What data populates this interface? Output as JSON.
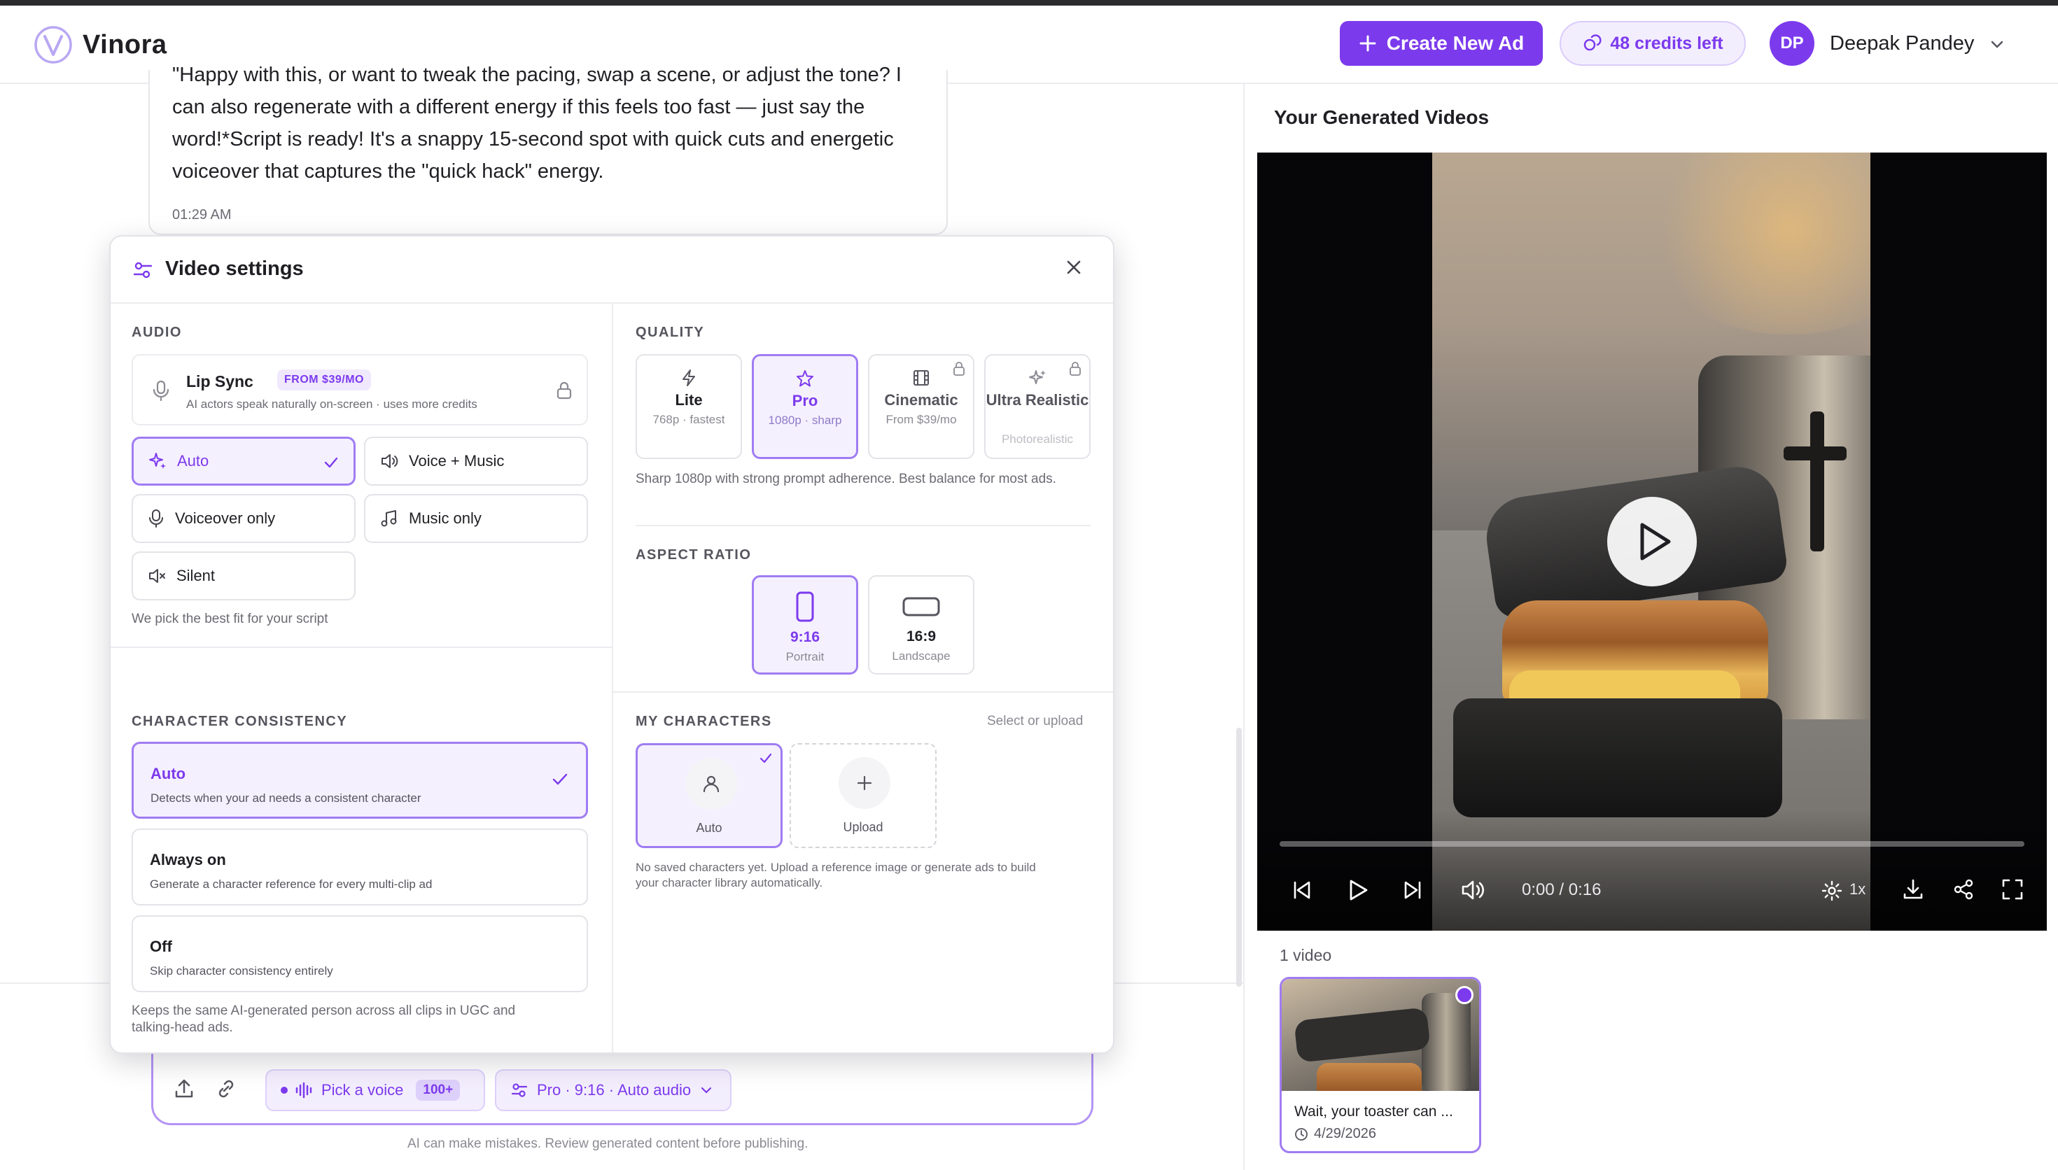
{
  "app": {
    "name": "Vinora"
  },
  "header": {
    "create_label": "Create New Ad",
    "credits_label": "48 credits left",
    "user_initials": "DP",
    "user_name": "Deepak Pandey"
  },
  "chat": {
    "message_lines": [
      "\"Happy with this, or want to tweak the pacing, swap a scene, or adjust the tone? I",
      "can also regenerate with a different energy if this feels too fast — just say the",
      "word!*Script is ready! It's a snappy 15-second spot with quick cuts and energetic",
      "voiceover that captures the \"quick hack\" energy."
    ],
    "time": "01:29 AM"
  },
  "composer": {
    "voice_label": "Pick a voice",
    "voice_count": "100+",
    "settings_summary": "Pro · 9:16 · Auto audio",
    "disclaimer": "AI can make mistakes. Review generated content before publishing."
  },
  "modal": {
    "title": "Video settings",
    "audio": {
      "section_label": "AUDIO",
      "lipsync_title": "Lip Sync",
      "lipsync_badge": "FROM $39/MO",
      "lipsync_desc": "AI actors speak naturally on-screen · uses more credits",
      "options": [
        {
          "label": "Auto",
          "selected": true
        },
        {
          "label": "Voice + Music",
          "selected": false
        },
        {
          "label": "Voiceover only",
          "selected": false
        },
        {
          "label": "Music only",
          "selected": false
        },
        {
          "label": "Silent",
          "selected": false
        }
      ],
      "hint": "We pick the best fit for your script"
    },
    "quality": {
      "section_label": "QUALITY",
      "cards": [
        {
          "title": "Lite",
          "sub": "768p · fastest",
          "selected": false,
          "locked": false
        },
        {
          "title": "Pro",
          "sub": "1080p · sharp",
          "selected": true,
          "locked": false
        },
        {
          "title": "Cinematic",
          "sub": "From $39/mo",
          "selected": false,
          "locked": true
        },
        {
          "title": "Ultra Realistic",
          "sub": "Photorealistic",
          "selected": false,
          "locked": true
        }
      ],
      "hint": "Sharp 1080p with strong prompt adherence. Best balance for most ads."
    },
    "aspect": {
      "section_label": "ASPECT RATIO",
      "cards": [
        {
          "title": "9:16",
          "sub": "Portrait",
          "selected": true
        },
        {
          "title": "16:9",
          "sub": "Landscape",
          "selected": false
        }
      ]
    },
    "consistency": {
      "section_label": "CHARACTER CONSISTENCY",
      "options": [
        {
          "title": "Auto",
          "desc": "Detects when your ad needs a consistent character",
          "selected": true
        },
        {
          "title": "Always on",
          "desc": "Generate a character reference for every multi-clip ad",
          "selected": false
        },
        {
          "title": "Off",
          "desc": "Skip character consistency entirely",
          "selected": false
        }
      ],
      "hint_line1": "Keeps the same AI-generated person across all clips in UGC and",
      "hint_line2": "talking-head ads."
    },
    "characters": {
      "section_label": "MY CHARACTERS",
      "side_hint": "Select or upload",
      "auto_label": "Auto",
      "upload_label": "Upload",
      "hint_line1": "No saved characters yet. Upload a reference image or generate ads to build",
      "hint_line2": "your character library automatically."
    }
  },
  "videos": {
    "panel_title": "Your Generated Videos",
    "time_display": "0:00 / 0:16",
    "speed": "1x",
    "progress": 0,
    "count_label": "1 video",
    "items": [
      {
        "title": "Wait, your toaster can ...",
        "date": "4/29/2026"
      }
    ]
  },
  "colors": {
    "accent": "#7c3aed",
    "accent_light": "#f5f0fe",
    "accent_border": "#a07cf2"
  }
}
